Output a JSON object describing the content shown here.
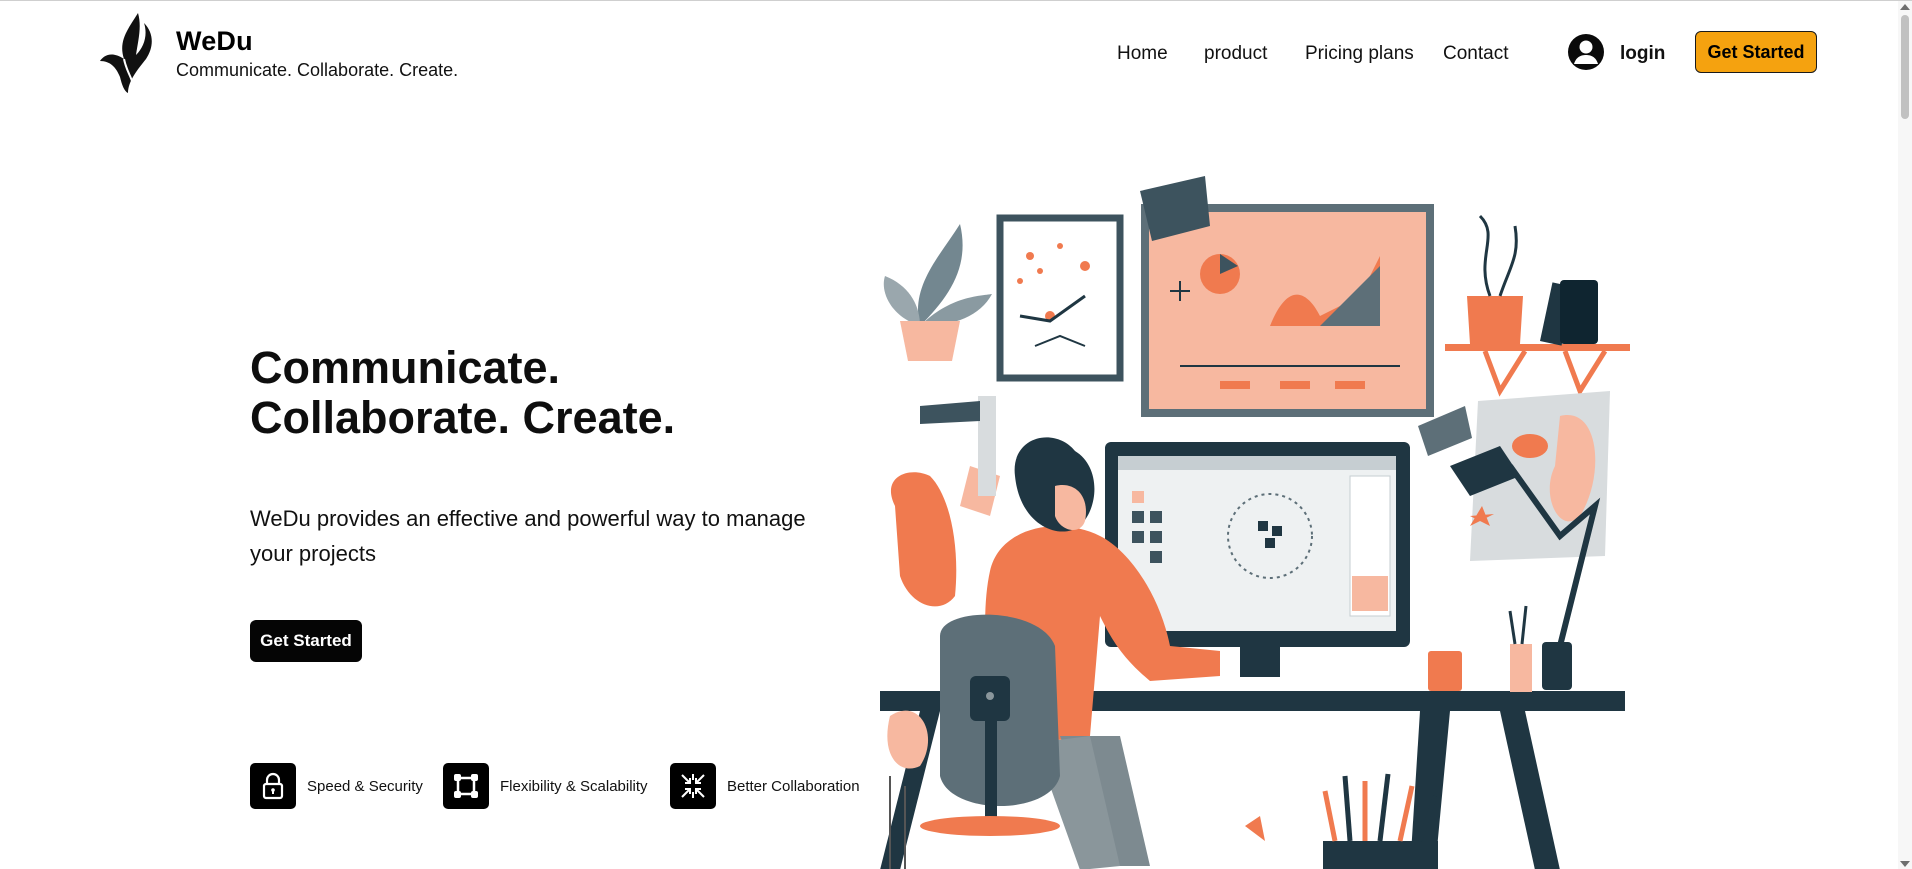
{
  "header": {
    "brand_name": "WeDu",
    "brand_tagline": "Communicate. Collaborate. Create.",
    "logo_icon": "flame-logo-icon",
    "nav": [
      {
        "label": "Home"
      },
      {
        "label": "product"
      },
      {
        "label": "Pricing plans"
      },
      {
        "label": "Contact"
      }
    ],
    "login_icon": "user-circle-icon",
    "login_label": "login",
    "cta_label": "Get Started",
    "cta_color": "#f5a20f"
  },
  "hero": {
    "title_line1": "Communicate.",
    "title_line2": "Collaborate. Create.",
    "subtitle": "WeDu provides an effective and powerful way to manage your projects",
    "cta_label": "Get Started",
    "illustration": "designer-at-desk-illustration"
  },
  "features": [
    {
      "icon": "lock-icon",
      "label": "Speed & Security"
    },
    {
      "icon": "frame-icon",
      "label": "Flexibility & Scalability"
    },
    {
      "icon": "collapse-arrows-icon",
      "label": "Better Collaboration"
    }
  ],
  "colors": {
    "accent_orange": "#f07a4f",
    "dark_slate": "#1f3642",
    "peach": "#f7b8a0"
  }
}
